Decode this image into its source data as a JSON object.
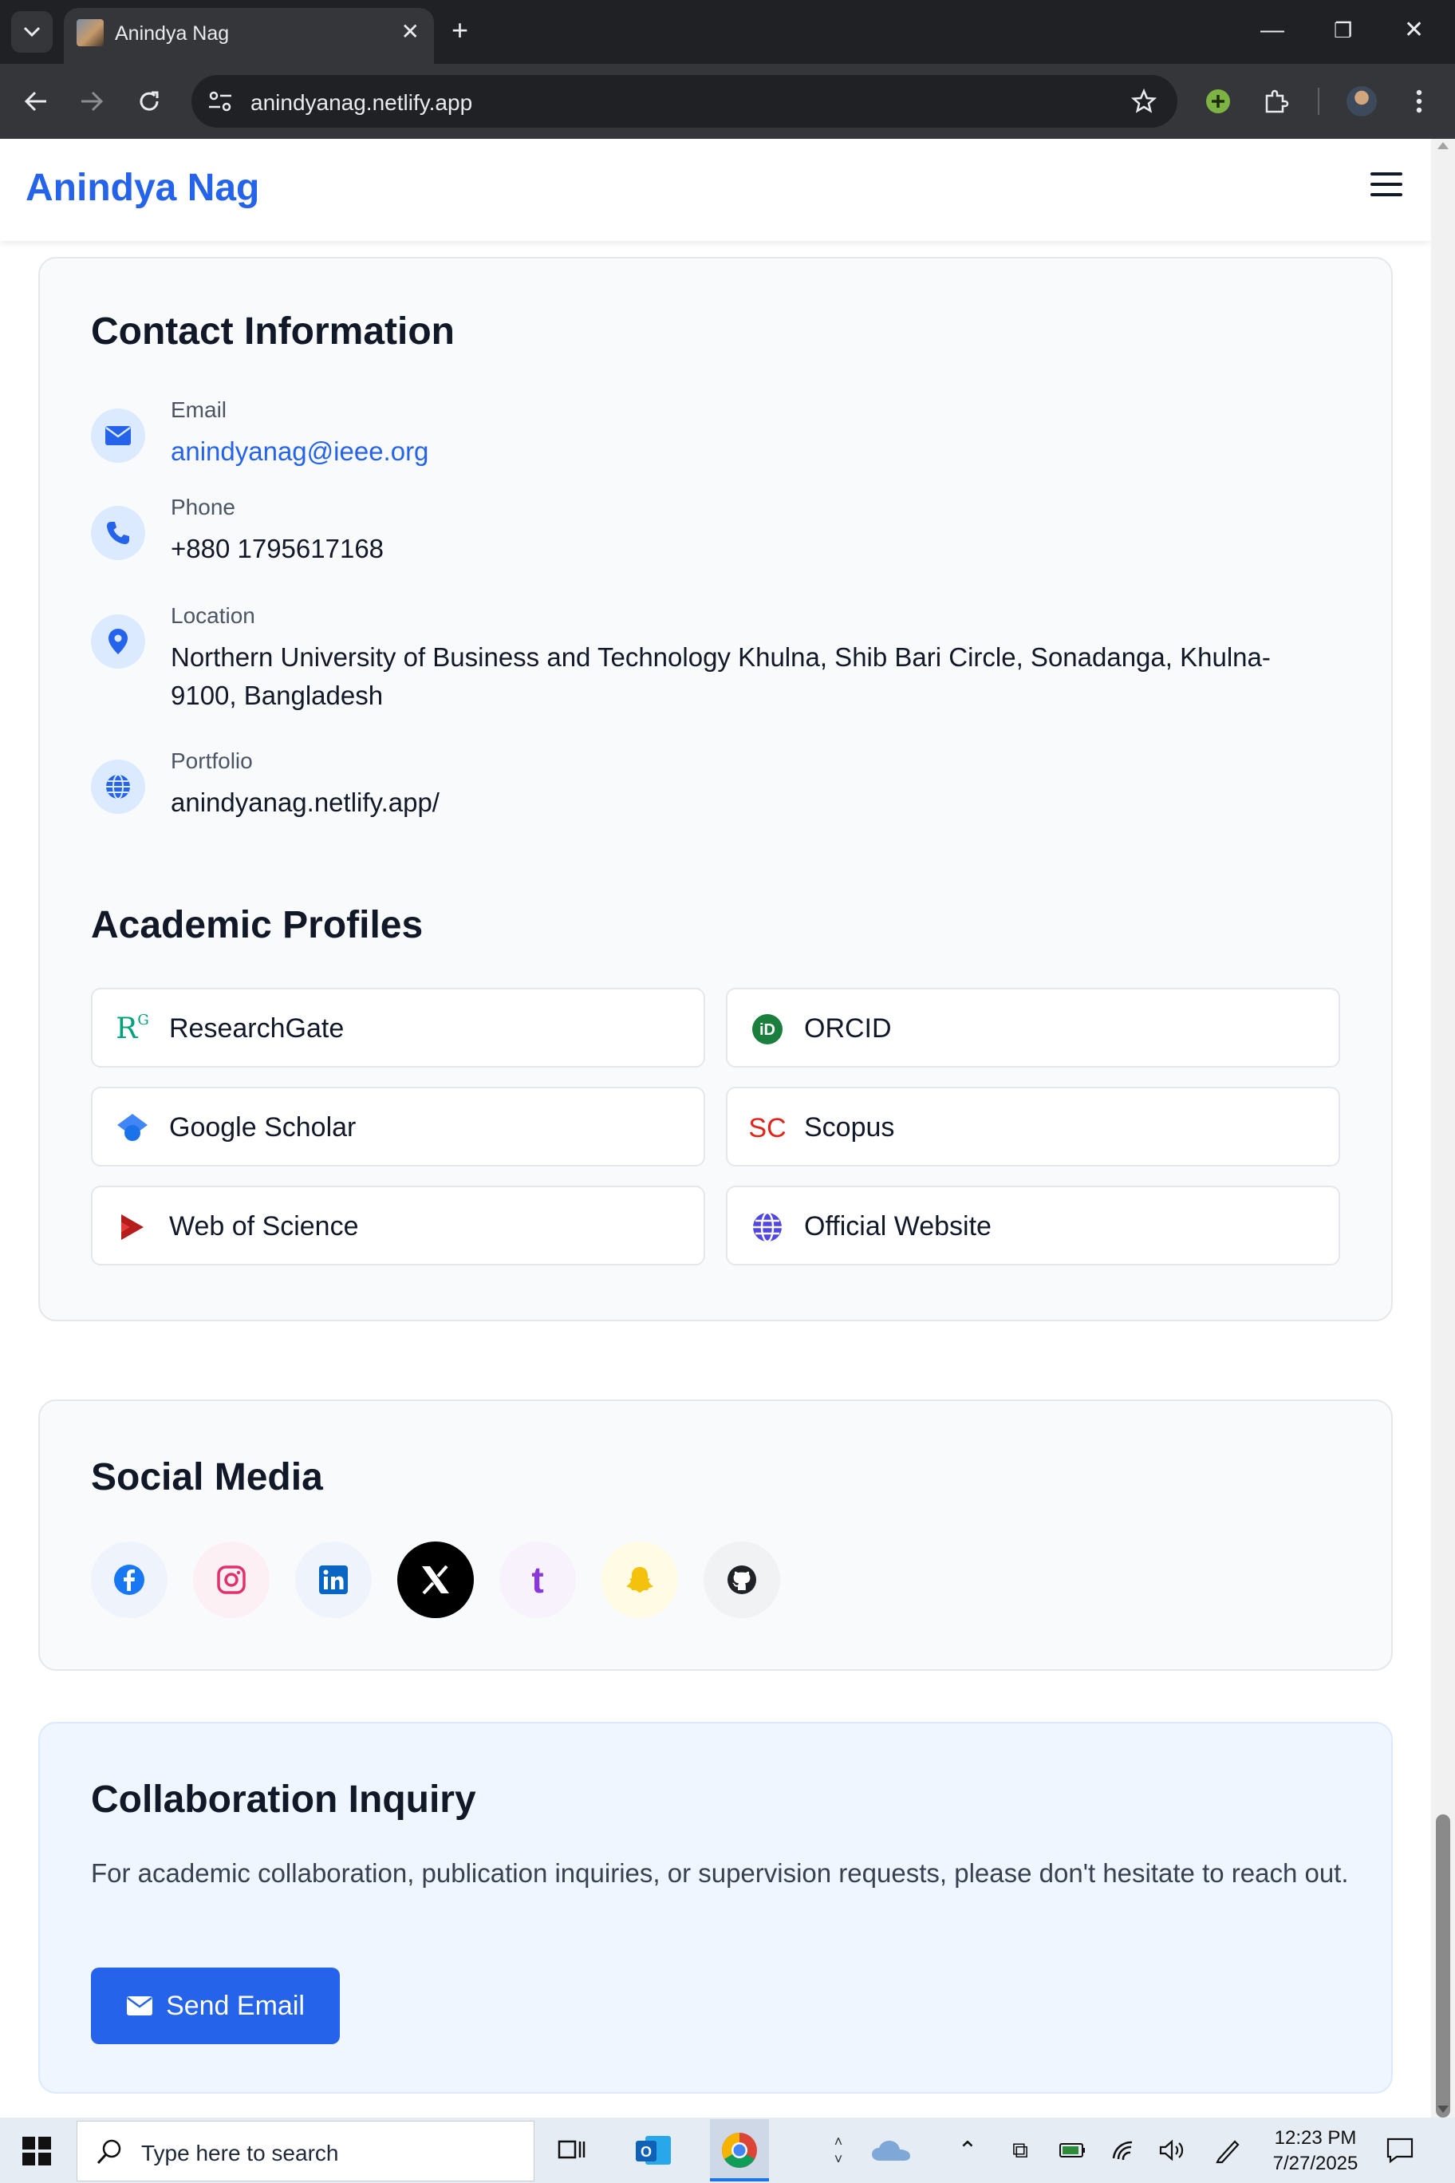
{
  "browser": {
    "tab_title": "Anindya Nag",
    "url": "anindyanag.netlify.app"
  },
  "site": {
    "brand": "Anindya Nag"
  },
  "contact": {
    "heading": "Contact Information",
    "items": [
      {
        "label": "Email",
        "value": "anindyanag@ieee.org",
        "icon": "envelope-icon"
      },
      {
        "label": "Phone",
        "value": "+880 1795617168",
        "icon": "phone-icon"
      },
      {
        "label": "Location",
        "value": "Northern University of Business and Technology Khulna, Shib Bari Circle, Sonadanga, Khulna-9100, Bangladesh",
        "icon": "location-pin-icon"
      },
      {
        "label": "Portfolio",
        "value": "anindyanag.netlify.app/",
        "icon": "globe-icon"
      }
    ]
  },
  "academic": {
    "heading": "Academic Profiles",
    "profiles": [
      {
        "label": "ResearchGate",
        "icon": "researchgate-icon"
      },
      {
        "label": "ORCID",
        "icon": "orcid-icon"
      },
      {
        "label": "Google Scholar",
        "icon": "google-scholar-icon"
      },
      {
        "label": "Scopus",
        "icon": "scopus-icon"
      },
      {
        "label": "Web of Science",
        "icon": "web-of-science-icon"
      },
      {
        "label": "Official Website",
        "icon": "globe-icon"
      }
    ]
  },
  "social": {
    "heading": "Social Media",
    "links": [
      "facebook",
      "instagram",
      "linkedin",
      "x",
      "tumblr",
      "snapchat",
      "github"
    ]
  },
  "collab": {
    "heading": "Collaboration Inquiry",
    "text": "For academic collaboration, publication inquiries, or supervision requests, please don't hesitate to reach out.",
    "button": "Send Email"
  },
  "taskbar": {
    "search_placeholder": "Type here to search",
    "time": "12:23 PM",
    "date": "7/27/2025"
  },
  "colors": {
    "accent": "#2563eb",
    "chrome_dark": "#202124",
    "chrome_toolbar": "#35363a"
  }
}
